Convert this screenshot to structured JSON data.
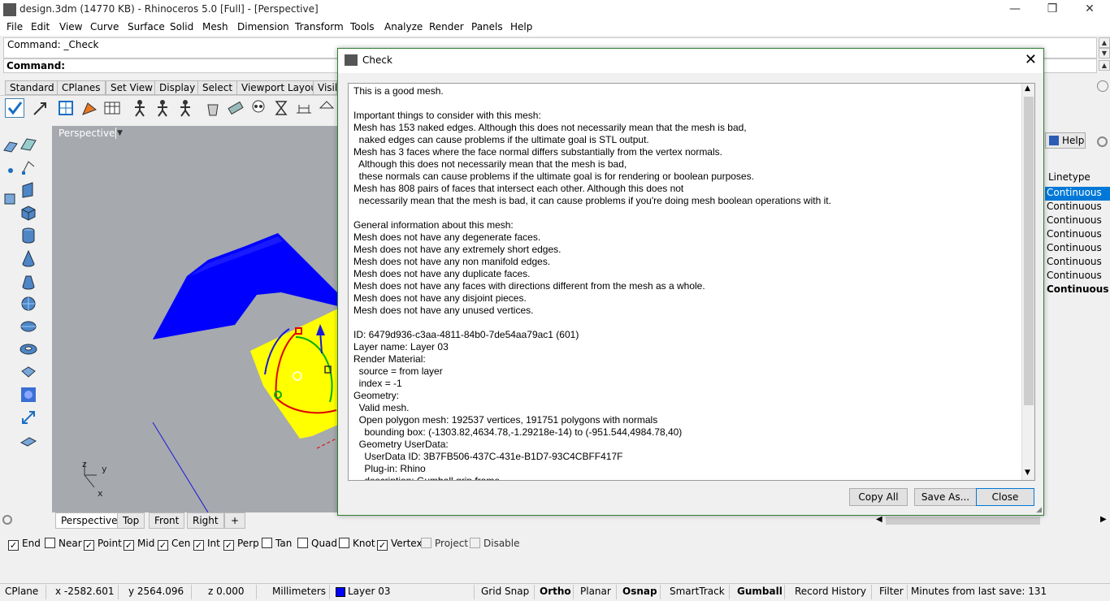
{
  "window": {
    "title": "design.3dm (14770 KB) - Rhinoceros 5.0 [Full] - [Perspective]",
    "min": "—",
    "restore": "❒",
    "close": "✕"
  },
  "menu": [
    "File",
    "Edit",
    "View",
    "Curve",
    "Surface",
    "Solid",
    "Mesh",
    "Dimension",
    "Transform",
    "Tools",
    "Analyze",
    "Render",
    "Panels",
    "Help"
  ],
  "command": {
    "history": "Command: _Check",
    "prompt": "Command:"
  },
  "toolbar_tabs": [
    "Standard",
    "CPlanes",
    "Set View",
    "Display",
    "Select",
    "Viewport Layout",
    "Visib"
  ],
  "viewport": {
    "title": "Perspective",
    "tabs": [
      "Perspective",
      "Top",
      "Front",
      "Right",
      "+"
    ],
    "axes": {
      "z": "z",
      "y": "y",
      "x": "x"
    }
  },
  "right_panel": {
    "help_tab": "Help",
    "column_header": "Linetype",
    "rows": [
      "Continuous",
      "Continuous",
      "Continuous",
      "Continuous",
      "Continuous",
      "Continuous",
      "Continuous",
      "Continuous"
    ]
  },
  "osnap": [
    {
      "label": "End",
      "checked": true
    },
    {
      "label": "Near",
      "checked": false
    },
    {
      "label": "Point",
      "checked": true
    },
    {
      "label": "Mid",
      "checked": true
    },
    {
      "label": "Cen",
      "checked": true
    },
    {
      "label": "Int",
      "checked": true
    },
    {
      "label": "Perp",
      "checked": true
    },
    {
      "label": "Tan",
      "checked": false
    },
    {
      "label": "Quad",
      "checked": false
    },
    {
      "label": "Knot",
      "checked": false
    },
    {
      "label": "Vertex",
      "checked": true
    },
    {
      "label": "Project",
      "checked": false
    },
    {
      "label": "Disable",
      "checked": false
    }
  ],
  "status": {
    "cplane": "CPlane",
    "x": "x -2582.601",
    "y": "y 2564.096",
    "z": "z 0.000",
    "units": "Millimeters",
    "layer": "Layer 03",
    "layer_color": "#0000ff",
    "grid_snap": "Grid Snap",
    "ortho": "Ortho",
    "planar": "Planar",
    "osnap": "Osnap",
    "smarttrack": "SmartTrack",
    "gumball": "Gumball",
    "record_history": "Record History",
    "filter": "Filter",
    "save_info": "Minutes from last save: 131"
  },
  "dialog": {
    "title": "Check",
    "close": "✕",
    "report": "This is a good mesh.\n\nImportant things to consider with this mesh:\nMesh has 153 naked edges. Although this does not necessarily mean that the mesh is bad,\n  naked edges can cause problems if the ultimate goal is STL output.\nMesh has 3 faces where the face normal differs substantially from the vertex normals.\n  Although this does not necessarily mean that the mesh is bad,\n  these normals can cause problems if the ultimate goal is for rendering or boolean purposes.\nMesh has 808 pairs of faces that intersect each other. Although this does not\n  necessarily mean that the mesh is bad, it can cause problems if you're doing mesh boolean operations with it.\n\nGeneral information about this mesh:\nMesh does not have any degenerate faces.\nMesh does not have any extremely short edges.\nMesh does not have any non manifold edges.\nMesh does not have any duplicate faces.\nMesh does not have any faces with directions different from the mesh as a whole.\nMesh does not have any disjoint pieces.\nMesh does not have any unused vertices.\n\nID: 6479d936-c3aa-4811-84b0-7de54aa79ac1 (601)\nLayer name: Layer 03\nRender Material:\n  source = from layer\n  index = -1\nGeometry:\n  Valid mesh.\n  Open polygon mesh: 192537 vertices, 191751 polygons with normals\n    bounding box: (-1303.82,4634.78,-1.29218e-14) to (-951.544,4984.78,40)\n  Geometry UserData:\n    UserData ID: 3B7FB506-437C-431e-B1D7-93C4CBFF417F\n    Plug-in: Rhino\n    description: Gumball grip frame",
    "buttons": {
      "copy_all": "Copy All",
      "save_as": "Save As...",
      "close": "Close"
    }
  },
  "colors": {
    "viewport_bg": "#a6a9ae",
    "mesh_blue": "#0000ff",
    "mesh_yellow": "#ffff00",
    "dialog_border": "#2e7d32",
    "selected_row": "#0078d7"
  }
}
